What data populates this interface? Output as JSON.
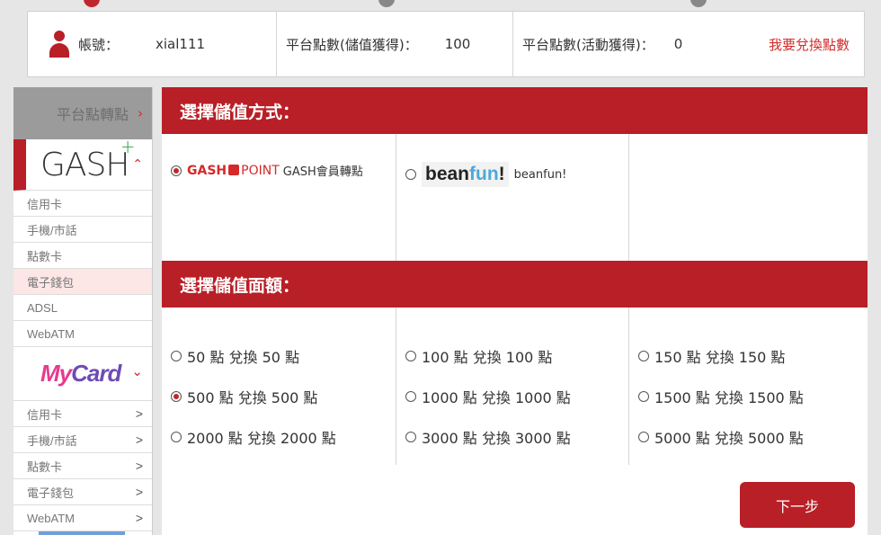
{
  "info": {
    "account_label": "帳號：",
    "account_value": "xial111",
    "points_stored_label": "平台點數(儲值獲得)：",
    "points_stored_value": "100",
    "points_event_label": "平台點數(活動獲得)：",
    "points_event_value": "0",
    "exchange_link": "我要兌換點數"
  },
  "sidebar": {
    "header": "平台點轉點",
    "header_arrow": "›",
    "gash": {
      "logo_text": "GASH",
      "chev": "⌃",
      "items": [
        "信用卡",
        "手機/市話",
        "點數卡",
        "電子錢包",
        "ADSL",
        "WebATM"
      ]
    },
    "mycard": {
      "logo_my": "My",
      "logo_card": "Card",
      "chev": "⌄",
      "items": [
        "信用卡",
        "手機/市話",
        "點數卡",
        "電子錢包",
        "WebATM"
      ]
    }
  },
  "main": {
    "method_title": "選擇儲值方式：",
    "methods": [
      {
        "logo_gash": "GASH",
        "logo_point": "POINT",
        "label": "GASH會員轉點",
        "selected": true
      },
      {
        "logo_bean": "bean",
        "logo_fun": "fun",
        "logo_bang": "!",
        "label": "beanfun!",
        "selected": false
      }
    ],
    "amount_title": "選擇儲值面額：",
    "amounts": [
      [
        "50 點 兌換 50 點",
        "500 點 兌換 500 點",
        "2000 點 兌換 2000 點"
      ],
      [
        "100 點 兌換 100 點",
        "1000 點 兌換 1000 點",
        "3000 點 兌換 3000 點"
      ],
      [
        "150 點 兌換 150 點",
        "1500 點 兌換 1500 點",
        "5000 點 兌換 5000 點"
      ]
    ],
    "selected_amount": "500 點 兌換 500 點",
    "next_label": "下一步"
  },
  "colors": {
    "accent": "#b81f26",
    "link": "#d42a2a"
  }
}
